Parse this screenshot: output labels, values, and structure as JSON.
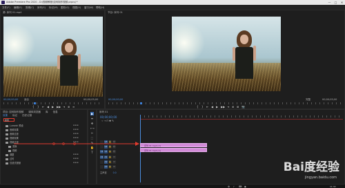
{
  "window": {
    "title": "Adobe Premiere Pro 2020 - D:\\视频教程\\如何制作视频.prproj *",
    "minimize": "—",
    "maximize": "□",
    "close": "✕"
  },
  "menu": [
    "文件(F)",
    "编辑(E)",
    "剪辑(C)",
    "序列(S)",
    "标记(M)",
    "图形(G)",
    "视图(V)",
    "窗口(W)",
    "帮助(H)"
  ],
  "source_monitor": {
    "tab_label": "源: 序列 01.mp4",
    "timecode": "00;00;00;00",
    "fit_label": "适合",
    "duration": "00;00;05;00",
    "controls": [
      "{",
      "}",
      "⇤",
      "◀",
      "▶",
      "▶▶",
      "⇥",
      "⊕",
      "≡"
    ]
  },
  "program_monitor": {
    "tab_label": "节目: 序列 01",
    "timecode": "00;00;00;00",
    "fit_label": "完整",
    "duration": "00;00;05;00",
    "controls": [
      "{",
      "}",
      "⇤",
      "◀",
      "▶",
      "▶▶",
      "⇥",
      "⊕",
      "⊞",
      "📷"
    ]
  },
  "project_panel": {
    "tabs": [
      "项目: 如何制作视频",
      "媒体浏览器",
      "库",
      "信息",
      "效果",
      "标记",
      "历史记录"
    ],
    "search_placeholder": "搜索",
    "items": [
      {
        "name": "Lumetri 预设",
        "kind": "folder"
      },
      {
        "name": "音频效果",
        "kind": "folder"
      },
      {
        "name": "音频过渡",
        "kind": "folder"
      },
      {
        "name": "视频效果",
        "kind": "folder"
      },
      {
        "name": "视频过渡",
        "kind": "folder"
      },
      {
        "name": "变换",
        "kind": "folder"
      },
      {
        "name": "视频",
        "kind": "folder"
      },
      {
        "name": "调整",
        "kind": "folder"
      },
      {
        "name": "过时",
        "kind": "folder"
      },
      {
        "name": "沉浸式视频",
        "kind": "folder"
      }
    ]
  },
  "tools": [
    "▶",
    "⇹",
    "✥",
    "⟷",
    "✂",
    "⬚",
    "✎",
    "✋",
    "T"
  ],
  "timeline": {
    "tab_label": "序列 01",
    "timecode": "00;00;00;00",
    "tracks": [
      {
        "label": "V3",
        "eye": "👁"
      },
      {
        "label": "V2",
        "eye": "👁"
      },
      {
        "label": "V1",
        "eye": "👁"
      },
      {
        "label": "A1",
        "eye": "M"
      },
      {
        "label": "A2",
        "eye": "M"
      },
      {
        "label": "A3",
        "eye": "M"
      }
    ],
    "master_label": "主声道",
    "master_value": "0.0",
    "clips": [
      {
        "label": "序列 01.mp4 [V]",
        "track": "V1"
      },
      {
        "label": "序列 01.mp4 [A]",
        "track": "A1"
      }
    ]
  },
  "watermark": {
    "text": "Bai度经验",
    "url": "jingyan.baidu.com"
  },
  "taskbar": {
    "items": [
      "中",
      "♪",
      "⌨",
      "▣"
    ],
    "clock": "11:32"
  },
  "colors": {
    "accent_blue": "#4c8fe0",
    "clip_pink": "#d28bd8",
    "annotation_red": "#e23b2e"
  }
}
